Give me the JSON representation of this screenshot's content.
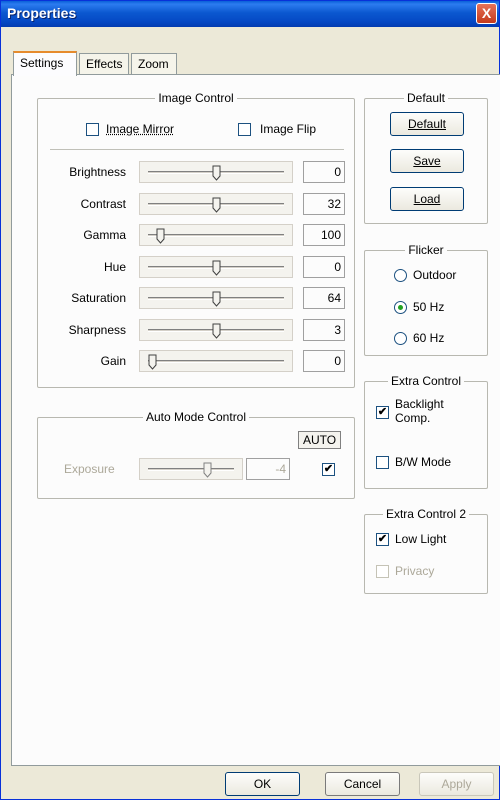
{
  "window": {
    "title": "Properties",
    "close_label": "X"
  },
  "tabs": [
    "Settings",
    "Effects",
    "Zoom"
  ],
  "image_control": {
    "title": "Image Control",
    "mirror_label": "Image Mirror",
    "mirror_checked": false,
    "flip_label": "Image Flip",
    "flip_checked": false,
    "sliders": [
      {
        "label": "Brightness",
        "value": "0",
        "level": 0.5
      },
      {
        "label": "Contrast",
        "value": "32",
        "level": 0.5
      },
      {
        "label": "Gamma",
        "value": "100",
        "level": 0.06
      },
      {
        "label": "Hue",
        "value": "0",
        "level": 0.5
      },
      {
        "label": "Saturation",
        "value": "64",
        "level": 0.5
      },
      {
        "label": "Sharpness",
        "value": "3",
        "level": 0.5
      },
      {
        "label": "Gain",
        "value": "0",
        "level": 0.0
      }
    ]
  },
  "auto_mode": {
    "title": "Auto Mode Control",
    "auto_label": "AUTO",
    "exposure_label": "Exposure",
    "exposure_value": "-4",
    "exposure_level": 0.7,
    "auto_checked": true
  },
  "default_group": {
    "title": "Default",
    "default_label": "Default",
    "save_label": "Save",
    "load_label": "Load"
  },
  "flicker": {
    "title": "Flicker",
    "options": [
      {
        "label": "Outdoor",
        "selected": false
      },
      {
        "label": "50 Hz",
        "selected": true
      },
      {
        "label": "60 Hz",
        "selected": false
      }
    ]
  },
  "extra_control": {
    "title": "Extra Control",
    "backlight_label_1": "Backlight",
    "backlight_label_2": "Comp.",
    "backlight_checked": true,
    "bw_label": "B/W Mode",
    "bw_checked": false
  },
  "extra_control_2": {
    "title": "Extra Control 2",
    "lowlight_label": "Low Light",
    "lowlight_checked": true,
    "privacy_label": "Privacy",
    "privacy_checked": false
  },
  "footer": {
    "ok_label": "OK",
    "cancel_label": "Cancel",
    "apply_label": "Apply"
  }
}
